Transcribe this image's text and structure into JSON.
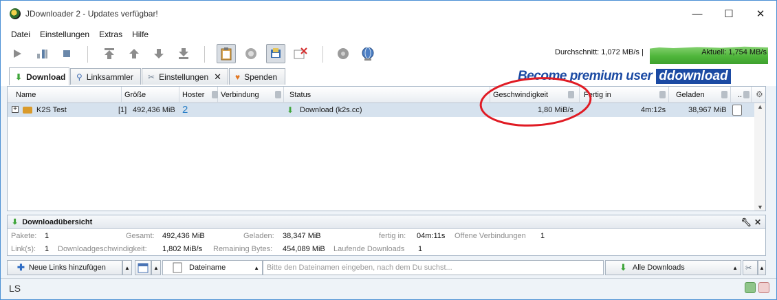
{
  "window": {
    "title": "JDownloader 2 - Updates verfügbar!",
    "minimize_glyph": "—",
    "maximize_glyph": "☐",
    "close_glyph": "✕"
  },
  "menu": [
    "Datei",
    "Einstellungen",
    "Extras",
    "Hilfe"
  ],
  "toolbar": {
    "icons": [
      "play-icon",
      "pause-icon",
      "stop-icon",
      "move-top-icon",
      "move-up-icon",
      "move-down-icon",
      "move-bottom-icon",
      "clipboard-icon",
      "reconnect-icon",
      "premium-toggle-icon",
      "clear-icon",
      "update-icon",
      "globe-icon"
    ],
    "speed_average": "Durchschnitt: 1,072 MB/s |",
    "speed_current": "Aktuell: 1,754 MB/s"
  },
  "tabs": [
    {
      "label": "Download",
      "icon": "download-arrow-icon"
    },
    {
      "label": "Linksammler",
      "icon": "magnifier-icon"
    },
    {
      "label": "Einstellungen",
      "icon": "tools-icon"
    },
    {
      "label": "Spenden",
      "icon": "heart-icon"
    }
  ],
  "settings_tab_close": "✕",
  "premium": {
    "text": "Become premium user",
    "logo": "ddownload"
  },
  "table": {
    "columns": [
      "Name",
      "Größe",
      "Hoster",
      "Verbindung",
      "Status",
      "Geschwindigkeit",
      "Fertig in",
      "Geladen",
      ".."
    ],
    "rows": [
      {
        "expand": "+",
        "name": "K2S Test",
        "count": "[1]",
        "size": "492,436 MiB",
        "hoster": "2",
        "status": "Download (k2s.cc)",
        "speed": "1,80 MiB/s",
        "eta": "4m:12s",
        "loaded": "38,967 MiB"
      }
    ]
  },
  "overview": {
    "title": "Downloadübersicht",
    "labels": {
      "packages": "Pakete:",
      "total": "Gesamt:",
      "loaded": "Geladen:",
      "done_in": "fertig in:",
      "open_conn": "Offene Verbindungen",
      "links": "Link(s):",
      "dl_speed": "Downloadgeschwindigkeit:",
      "remaining": "Remaining Bytes:",
      "running": "Laufende Downloads"
    },
    "values": {
      "packages": "1",
      "total": "492,436 MiB",
      "loaded": "38,347 MiB",
      "done_in": "04m:11s",
      "open_conn": "1",
      "links": "1",
      "dl_speed": "1,802 MiB/s",
      "remaining": "454,089 MiB",
      "running": "1"
    }
  },
  "bottombar": {
    "add_links": "Neue Links hinzufügen",
    "filter_field": "Dateiname",
    "search_placeholder": "Bitte den Dateinamen eingeben, nach dem Du suchst...",
    "view_select": "Alle Downloads"
  },
  "statusbar": {
    "left": "LS"
  },
  "colors": {
    "accent": "#1b4aa3",
    "selection": "#d6e2ee",
    "highlight_ellipse": "#e01b24",
    "graph": "#4fb63b"
  }
}
